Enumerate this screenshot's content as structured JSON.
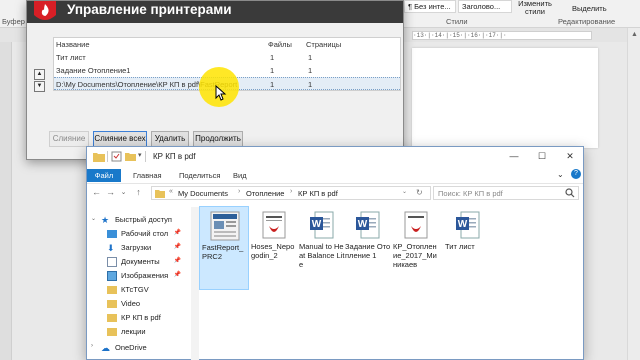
{
  "word": {
    "ribbon": {
      "clipboard_label": "Буфер",
      "styles": [
        "¶ Без инте...",
        "Заголово...",
        "Изменить стили"
      ],
      "styles_label": "Стили",
      "select_label": "Выделить",
      "editing_label": "Редактирование"
    },
    "ruler_text": "·13·|·14·|·15·|·16·|·17·|·"
  },
  "printer_dialog": {
    "title": "Управление принтерами",
    "columns": [
      "Название",
      "Файлы",
      "Страницы"
    ],
    "rows": [
      {
        "name": "Тит лист",
        "files": "1",
        "pages": "1"
      },
      {
        "name": "Задание Отопление1",
        "files": "1",
        "pages": "1"
      },
      {
        "name": "D:\\My Documents\\Отопление\\КР КП в pdf\\FastReport",
        "files": "1",
        "pages": "1"
      }
    ],
    "buttons": {
      "merge": "Слияние",
      "merge_all": "Слияние всех",
      "delete": "Удалить",
      "continue": "Продолжить"
    }
  },
  "explorer": {
    "title": "КР КП в pdf",
    "menu": {
      "file": "Файл",
      "home": "Главная",
      "share": "Поделиться",
      "view": "Вид"
    },
    "breadcrumb": [
      "My Documents",
      "Отопление",
      "КР КП в pdf"
    ],
    "search_placeholder": "Поиск: КР КП в pdf",
    "nav": [
      {
        "label": "Быстрый доступ",
        "icon": "star-icon",
        "pinned": false
      },
      {
        "label": "Рабочий стол",
        "icon": "desktop-icon",
        "pinned": true
      },
      {
        "label": "Загрузки",
        "icon": "downloads-icon",
        "pinned": true
      },
      {
        "label": "Документы",
        "icon": "documents-icon",
        "pinned": true
      },
      {
        "label": "Изображения",
        "icon": "pictures-icon",
        "pinned": true
      },
      {
        "label": "КТсTGV",
        "icon": "folder-icon",
        "pinned": false
      },
      {
        "label": "Video",
        "icon": "folder-icon",
        "pinned": false
      },
      {
        "label": "КР КП в pdf",
        "icon": "folder-icon",
        "pinned": false
      },
      {
        "label": "лекции",
        "icon": "folder-icon",
        "pinned": false
      },
      {
        "label": "OneDrive",
        "icon": "cloud-icon",
        "pinned": false
      }
    ],
    "files": [
      {
        "name": "FastReport_PRC2",
        "type": "report"
      },
      {
        "name": "Hoses_Nepogodin_2",
        "type": "pdf"
      },
      {
        "name": "Manual to Heat Balance Lite",
        "type": "word"
      },
      {
        "name": "Задание Отопление 1",
        "type": "word"
      },
      {
        "name": "КР_Отопление_2017_Миникаев",
        "type": "pdf"
      },
      {
        "name": "Тит лист",
        "type": "word"
      }
    ]
  },
  "colors": {
    "accent_blue": "#1979ca",
    "title_dark": "#3a3a3a",
    "selection_blue": "#cce8ff",
    "highlight_yellow": "#ffe400"
  }
}
